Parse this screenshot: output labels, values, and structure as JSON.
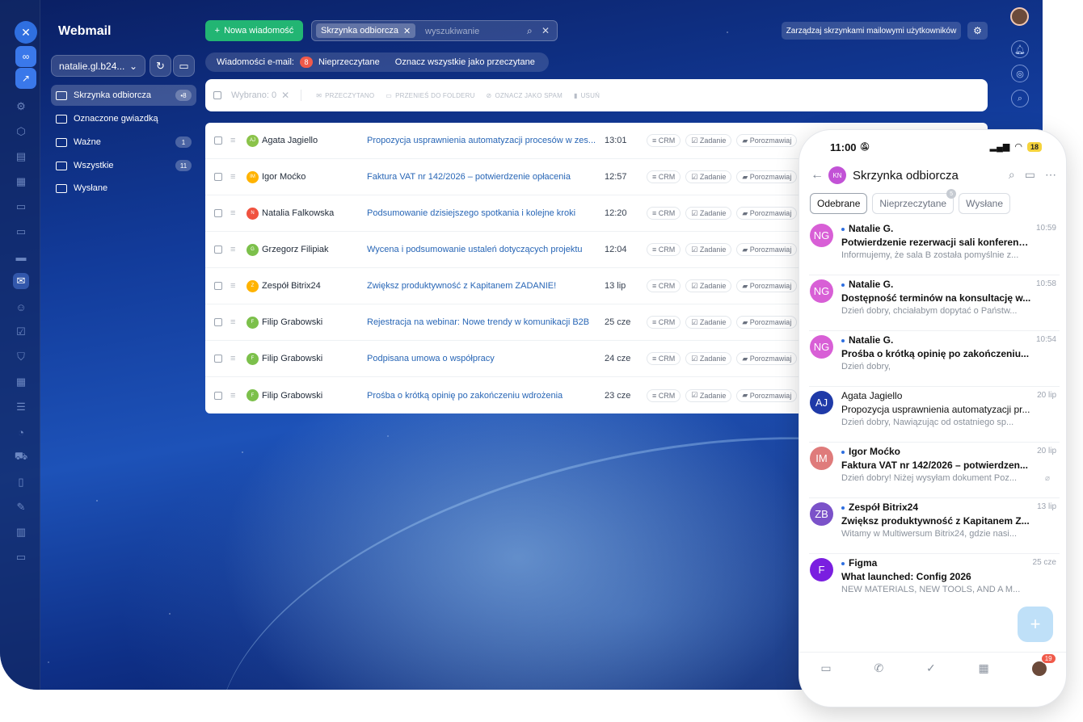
{
  "app": {
    "title": "Webmail"
  },
  "account": {
    "label": "natalie.gl.b24..."
  },
  "folders": [
    {
      "label": "Skrzynka odbiorcza",
      "badge": "•8",
      "active": true
    },
    {
      "label": "Oznaczone gwiazdką",
      "badge": ""
    },
    {
      "label": "Ważne",
      "badge": "1"
    },
    {
      "label": "Wszystkie",
      "badge": "11"
    },
    {
      "label": "Wysłane",
      "badge": ""
    }
  ],
  "toolbar": {
    "new_message": "Nowa wiadomość",
    "filter_chip": "Skrzynka odbiorcza",
    "search_placeholder": "wyszukiwanie",
    "manage_label": "Zarządzaj skrzynkami mailowymi użytkowników"
  },
  "status_bar": {
    "label": "Wiadomości e-mail:",
    "unread_count": "8",
    "unread_label": "Nieprzeczytane",
    "mark_all": "Oznacz wszystkie jako przeczytane"
  },
  "actions": {
    "selected": "Wybrano: 0",
    "read": "Przeczytano",
    "move": "Przenieś do folderu",
    "spam": "Oznacz jako spam",
    "delete": "Usuń"
  },
  "tags": {
    "crm": "CRM",
    "task": "Zadanie",
    "chat": "Porozmawiaj"
  },
  "emails": [
    {
      "initials": "AJ",
      "color": "#8bc34a",
      "sender": "Agata Jagiello",
      "subject": "Propozycja usprawnienia automatyzacji procesów w zes...",
      "time": "13:01"
    },
    {
      "initials": "IM",
      "color": "#ffb300",
      "sender": "Igor Moćko",
      "subject": "Faktura VAT nr 142/2026 – potwierdzenie opłacenia",
      "time": "12:57"
    },
    {
      "initials": "N",
      "color": "#f0523f",
      "sender": "Natalia Falkowska",
      "subject": "Podsumowanie dzisiejszego spotkania i kolejne kroki",
      "time": "12:20"
    },
    {
      "initials": "G",
      "color": "#7cc04b",
      "sender": "Grzegorz Filipiak",
      "subject": "Wycena i podsumowanie ustaleń dotyczących projektu",
      "time": "12:04"
    },
    {
      "initials": "Z",
      "color": "#ffb300",
      "sender": "Zespół Bitrix24",
      "subject": "Zwiększ produktywność z Kapitanem ZADANIE!",
      "time": "13 lip"
    },
    {
      "initials": "F",
      "color": "#7cc04b",
      "sender": "Filip Grabowski",
      "subject": "Rejestracja na webinar: Nowe trendy w komunikacji B2B",
      "time": "25 cze"
    },
    {
      "initials": "F",
      "color": "#7cc04b",
      "sender": "Filip Grabowski",
      "subject": "Podpisana umowa o współpracy",
      "time": "24 cze"
    },
    {
      "initials": "F",
      "color": "#7cc04b",
      "sender": "Filip Grabowski",
      "subject": "Prośba o krótką opinię po zakończeniu wdrożenia",
      "time": "23 cze"
    }
  ],
  "phone": {
    "clock": "11:00",
    "battery": "18",
    "avatar": "KN",
    "title": "Skrzynka odbiorcza",
    "tabs": [
      {
        "label": "Odebrane",
        "active": true,
        "dot": ""
      },
      {
        "label": "Nieprzeczytane",
        "active": false,
        "dot": "5"
      },
      {
        "label": "Wysłane",
        "active": false,
        "dot": ""
      }
    ],
    "messages": [
      {
        "initials": "NG",
        "color": "#d85fd6",
        "from": "Natalie G.",
        "unread": true,
        "time": "10:59",
        "subject": "Potwierdzenie rezerwacji sali konferenc...",
        "preview": "Informujemy, że sala B została pomyślnie z..."
      },
      {
        "initials": "NG",
        "color": "#d85fd6",
        "from": "Natalie G.",
        "unread": true,
        "time": "10:58",
        "subject": "Dostępność terminów na konsultację w...",
        "preview": "Dzień dobry, chciałabym dopytać o Państw..."
      },
      {
        "initials": "NG",
        "color": "#d85fd6",
        "from": "Natalie G.",
        "unread": true,
        "time": "10:54",
        "subject": "Prośba o krótką opinię po zakończeniu...",
        "preview": "Dzień dobry,"
      },
      {
        "initials": "AJ",
        "color": "#1f3aa8",
        "from": "Agata Jagiello",
        "unread": false,
        "time": "20 lip",
        "subject": "Propozycja usprawnienia automatyzacji pr...",
        "preview": "Dzień dobry, Nawiązując od ostatniego sp..."
      },
      {
        "initials": "IM",
        "color": "#df7b7b",
        "from": "Igor Moćko",
        "unread": true,
        "time": "20 lip",
        "subject": "Faktura VAT nr 142/2026 – potwierdzen...",
        "preview": "Dzień dobry! Niżej wysyłam dokument Poz..."
      },
      {
        "initials": "ZB",
        "color": "#7b52c9",
        "from": "Zespół Bitrix24",
        "unread": true,
        "time": "13 lip",
        "subject": "Zwiększ produktywność z Kapitanem Z...",
        "preview": "Witamy w Multiwersum Bitrix24, gdzie nasi..."
      },
      {
        "initials": "F",
        "color": "#7a1fe0",
        "from": "Figma",
        "unread": true,
        "time": "25 cze",
        "subject": "What launched: Config 2026",
        "preview": "NEW MATERIALS, NEW TOOLS, AND A M..."
      }
    ],
    "notifications": "19"
  }
}
